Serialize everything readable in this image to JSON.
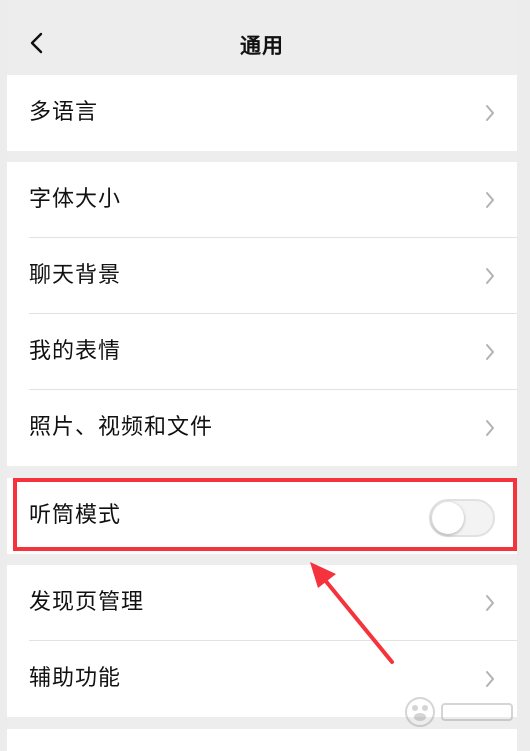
{
  "navbar": {
    "title": "通用",
    "back_icon": "chevron-left-icon"
  },
  "groups": [
    {
      "items": [
        {
          "label": "多语言",
          "control": "chevron"
        }
      ]
    },
    {
      "items": [
        {
          "label": "字体大小",
          "control": "chevron"
        },
        {
          "label": "聊天背景",
          "control": "chevron"
        },
        {
          "label": "我的表情",
          "control": "chevron"
        },
        {
          "label": "照片、视频和文件",
          "control": "chevron"
        }
      ]
    },
    {
      "items": [
        {
          "label": "听筒模式",
          "control": "toggle",
          "toggle_on": false
        }
      ]
    },
    {
      "items": [
        {
          "label": "发现页管理",
          "control": "chevron"
        },
        {
          "label": "辅助功能",
          "control": "chevron"
        }
      ]
    }
  ],
  "annotation": {
    "highlight_color": "#f4333c"
  },
  "colors": {
    "background": "#ededed",
    "card": "#ffffff",
    "chevron": "#b2b2b2"
  }
}
